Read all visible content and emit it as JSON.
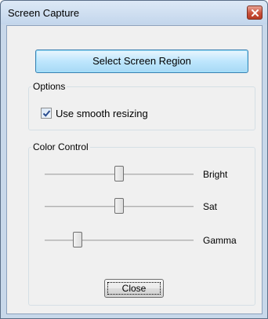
{
  "window": {
    "title": "Screen Capture",
    "close_icon": "close-x-icon"
  },
  "actions": {
    "select_region_label": "Select Screen Region",
    "close_label": "Close"
  },
  "options": {
    "group_label": "Options",
    "smooth_resizing": {
      "label": "Use smooth resizing",
      "checked": true
    }
  },
  "color_control": {
    "group_label": "Color Control",
    "sliders": [
      {
        "label": "Bright",
        "value": 0.5
      },
      {
        "label": "Sat",
        "value": 0.5
      },
      {
        "label": "Gamma",
        "value": 0.22
      }
    ]
  }
}
